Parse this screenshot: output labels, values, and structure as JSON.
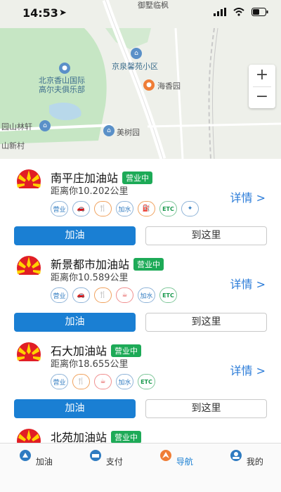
{
  "status_bar": {
    "time": "14:53"
  },
  "map": {
    "labels": {
      "top": "御墅临枫",
      "xiaoqu": "京泉馨苑小区",
      "golf": "北京香山国际\n高尔夫俱乐部",
      "haixiang": "海香园",
      "linxuan": "园山林轩",
      "meishu": "美树园",
      "xincun": "山新村"
    },
    "zoom_in": "+",
    "zoom_out": "−"
  },
  "stations": [
    {
      "name": "南平庄加油站",
      "status": "营业中",
      "distance": "距离你10.202公里",
      "details": "详情 >",
      "refuel": "加油",
      "navigate": "到这里",
      "tags": [
        "营业",
        "洗车",
        "餐饮",
        "加水",
        "加油",
        "ETC",
        "洗涤"
      ]
    },
    {
      "name": "新景都市加油站",
      "status": "营业中",
      "distance": "距离你10.589公里",
      "details": "详情 >",
      "refuel": "加油",
      "navigate": "到这里",
      "tags": [
        "营业",
        "洗车",
        "餐饮",
        "咖啡",
        "加水",
        "ETC"
      ]
    },
    {
      "name": "石大加油站",
      "status": "营业中",
      "distance": "距离你18.655公里",
      "details": "详情 >",
      "refuel": "加油",
      "navigate": "到这里",
      "tags": [
        "营业",
        "餐饮",
        "咖啡",
        "加水",
        "ETC"
      ]
    },
    {
      "name": "北苑加油站",
      "status": "营业中"
    }
  ],
  "tabs": [
    {
      "label": "加油",
      "icon": "refuel-icon"
    },
    {
      "label": "支付",
      "icon": "pay-icon"
    },
    {
      "label": "导航",
      "icon": "navigate-icon",
      "active": true
    },
    {
      "label": "我的",
      "icon": "profile-icon"
    }
  ],
  "colors": {
    "accent": "#1a7fd3",
    "open_badge": "#1daa57",
    "details_link": "#2a7bd8"
  }
}
